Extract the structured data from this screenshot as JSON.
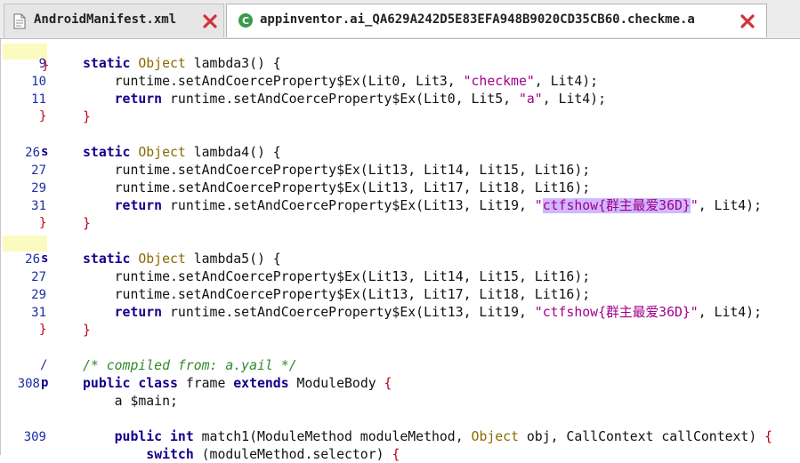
{
  "tabs": [
    {
      "label": "AndroidManifest.xml",
      "icon": "xml-file-icon",
      "active": false
    },
    {
      "label": "appinventor.ai_QA629A242D5E83EFA948B9020CD35CB60.checkme.a",
      "icon": "class-file-icon",
      "active": true
    }
  ],
  "gutter": [
    "9",
    "10",
    "11",
    "",
    "26",
    "27",
    "29",
    "31",
    "",
    "26",
    "27",
    "29",
    "31",
    "",
    "/",
    "308",
    "309"
  ],
  "lines": {
    "l9": [
      "static ",
      "Object ",
      "lambda3() {"
    ],
    "l10": [
      "    runtime.setAndCoerceProperty$Ex(Lit0, Lit3, ",
      "\"checkme\"",
      ", Lit4);"
    ],
    "l11": [
      "    ",
      "return ",
      "runtime.setAndCoerceProperty$Ex(Lit0, Lit5, ",
      "\"a\"",
      ", Lit4);"
    ],
    "l12": "}",
    "b1": [
      "static ",
      "Object ",
      "lambda4() {"
    ],
    "b2": "    runtime.setAndCoerceProperty$Ex(Lit13, Lit14, Lit15, Lit16);",
    "b3": "    runtime.setAndCoerceProperty$Ex(Lit13, Lit17, Lit18, Lit16);",
    "b4": [
      "    ",
      "return ",
      "runtime.setAndCoerceProperty$Ex(Lit13, Lit19, ",
      "\"",
      "ctfshow{群主最爱36D}",
      "\"",
      ", Lit4);"
    ],
    "b5": "}",
    "c1": [
      "static ",
      "Object ",
      "lambda5() {"
    ],
    "c2": "    runtime.setAndCoerceProperty$Ex(Lit13, Lit14, Lit15, Lit16);",
    "c3": "    runtime.setAndCoerceProperty$Ex(Lit13, Lit17, Lit18, Lit16);",
    "c4": [
      "    ",
      "return ",
      "runtime.setAndCoerceProperty$Ex(Lit13, Lit19, ",
      "\"ctfshow{群主最爱36D}\"",
      ", Lit4);"
    ],
    "c5": "}",
    "d1": "/* compiled from: a.yail */",
    "d2": [
      "public class ",
      "frame ",
      "extends ",
      "ModuleBody ",
      "{"
    ],
    "d3": "    a $main;",
    "d4": [
      "    ",
      "public int ",
      "match1(ModuleMethod moduleMethod, ",
      "Object ",
      "obj, CallContext callContext) ",
      "{"
    ],
    "d5": [
      "        ",
      "switch ",
      "(moduleMethod.selector) ",
      "{"
    ]
  },
  "gutter_marks": {
    "s": "s",
    "p": "p",
    "brace": "}",
    "slash": "/"
  }
}
